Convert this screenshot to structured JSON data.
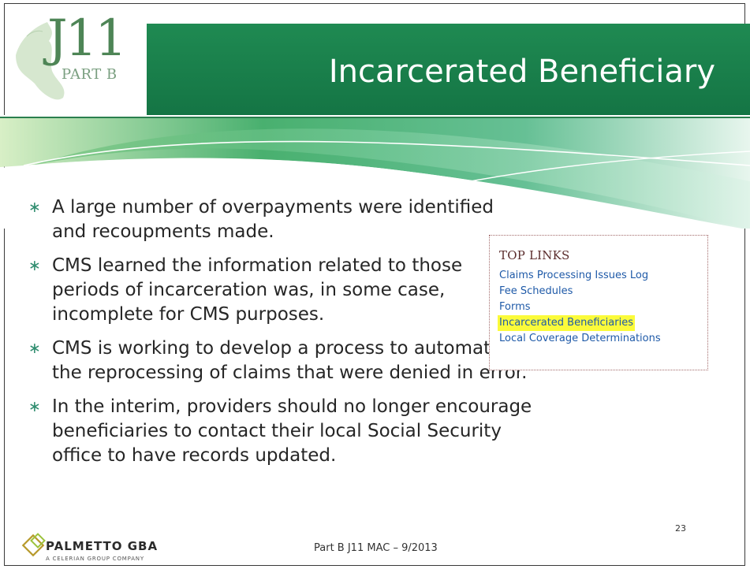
{
  "header": {
    "logo_main": "J11",
    "logo_sub": "PART B",
    "title": "Incarcerated Beneficiary"
  },
  "bullets": [
    "A large number of overpayments were identified and recoupments made.",
    "CMS learned the information related to those periods of incarceration was, in some case, incomplete for CMS purposes.",
    "CMS is working to develop a process to automate the reprocessing of claims that were denied in error.",
    "In the interim, providers should no longer encourage beneficiaries to contact their local Social Security office to have records updated."
  ],
  "top_links": {
    "heading": "TOP LINKS",
    "links": [
      "Claims Processing Issues Log",
      "Fee Schedules",
      "Forms",
      "Incarcerated Beneficiaries",
      "Local Coverage Determinations"
    ],
    "highlight_color": "#fbfb3a",
    "link_color": "#1f5aa8"
  },
  "footer": {
    "company": "PALMETTO GBA",
    "company_sub": "A CELERIAN GROUP COMPANY",
    "center_text": "Part B J11 MAC – 9/2013",
    "slide_number": "23"
  },
  "colors": {
    "header_green": "#1e8a54",
    "accent_green": "#2f8d6f"
  }
}
